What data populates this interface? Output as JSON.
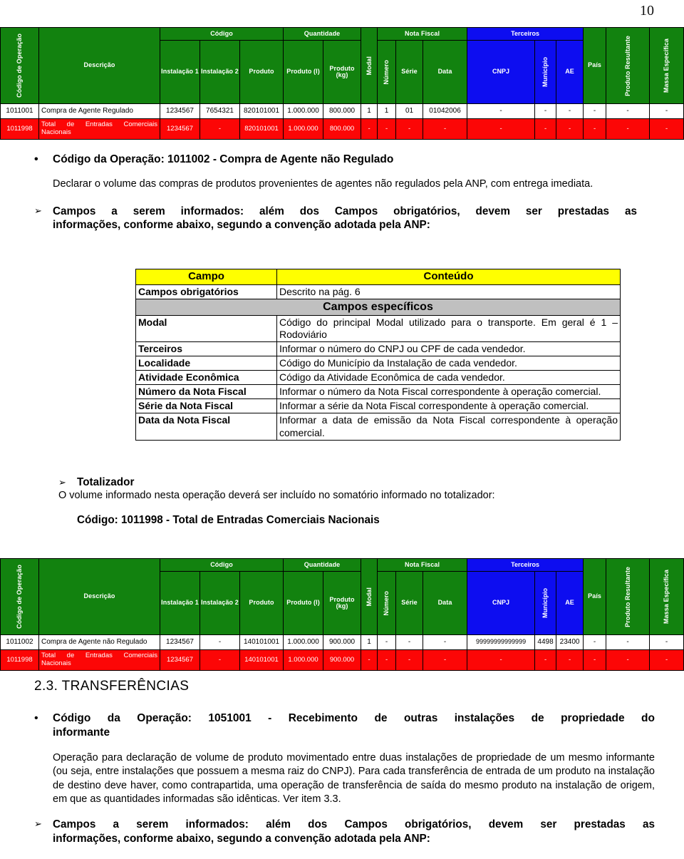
{
  "page": {
    "number": "10"
  },
  "table_top": {
    "group_headers": {
      "codigo": "Código",
      "quantidade": "Quantidade",
      "nota_fiscal": "Nota Fiscal",
      "terceiros": "Terceiros"
    },
    "columns": {
      "codigo_operacao": "Código de Operação",
      "descricao": "Descrição",
      "instalacao1": "Instalação 1",
      "instalacao2": "Instalação 2",
      "produto": "Produto",
      "produto_l": "Produto (l)",
      "produto_kg": "Produto (kg)",
      "modal": "Modal",
      "numero": "Número",
      "serie": "Série",
      "data": "Data",
      "cnpj": "CNPJ",
      "municipio": "Município",
      "ae": "AE",
      "pais": "País",
      "produto_resultante": "Produto Resultante",
      "massa_especifica": "Massa Específica"
    },
    "rows": [
      {
        "codigo_operacao": "1011001",
        "descricao": "Compra de Agente Regulado",
        "instalacao1": "1234567",
        "instalacao2": "7654321",
        "produto": "820101001",
        "produto_l": "1.000.000",
        "produto_kg": "800.000",
        "modal": "1",
        "numero": "1",
        "serie": "01",
        "data": "01042006",
        "cnpj": "-",
        "municipio": "-",
        "ae": "-",
        "pais": "-",
        "produto_resultante": "-",
        "massa_especifica": "-",
        "highlight": "white"
      },
      {
        "codigo_operacao": "1011998",
        "descricao": "Total de Entradas Comerciais Nacionais",
        "instalacao1": "1234567",
        "instalacao2": "-",
        "produto": "820101001",
        "produto_l": "1.000.000",
        "produto_kg": "800.000",
        "modal": "-",
        "numero": "-",
        "serie": "-",
        "data": "-",
        "cnpj": "-",
        "municipio": "-",
        "ae": "-",
        "pais": "-",
        "produto_resultante": "-",
        "massa_especifica": "-",
        "highlight": "red"
      }
    ]
  },
  "section_1011002": {
    "bullet": "•",
    "heading": "Código da Operação: 1011002 - Compra de Agente não Regulado",
    "description": "Declarar o volume das compras de produtos provenientes de agentes não regulados pela ANP, com entrega imediata.",
    "arrow": "➢",
    "campos_intro_line1": "Campos a serem informados: além dos Campos obrigatórios, devem ser prestadas as",
    "campos_intro_line2": "informações, conforme abaixo, segundo a convenção adotada pela ANP:"
  },
  "campo_table": {
    "header": {
      "campo": "Campo",
      "conteudo": "Conteúdo"
    },
    "obrigatorios": {
      "campo": "Campos obrigatórios",
      "conteudo": "Descrito na pág. 6"
    },
    "specific_banner": "Campos específicos",
    "rows": [
      {
        "campo": "Modal",
        "conteudo": "Código do principal Modal utilizado para o transporte. Em geral é 1 – Rodoviário"
      },
      {
        "campo": "Terceiros",
        "conteudo": "Informar o número do CNPJ ou CPF de cada vendedor."
      },
      {
        "campo": "Localidade",
        "conteudo": "Código do Município da Instalação de cada vendedor."
      },
      {
        "campo": "Atividade Econômica",
        "conteudo": "Código da Atividade Econômica de cada vendedor."
      },
      {
        "campo": "Número da Nota Fiscal",
        "conteudo": "Informar o número da Nota Fiscal correspondente à operação comercial."
      },
      {
        "campo": "Série da Nota Fiscal",
        "conteudo": "Informar a série da Nota Fiscal correspondente à operação comercial."
      },
      {
        "campo": "Data da Nota Fiscal",
        "conteudo": "Informar a data de emissão da Nota Fiscal correspondente à operação comercial."
      }
    ]
  },
  "totalizador": {
    "arrow": "➢",
    "title": "Totalizador",
    "text": "O volume informado nesta operação deverá ser incluído no somatório informado no totalizador:",
    "codigo": "Código: 1011998 - Total de Entradas Comerciais Nacionais"
  },
  "table_bottom": {
    "group_headers": {
      "codigo": "Código",
      "quantidade": "Quantidade",
      "nota_fiscal": "Nota Fiscal",
      "terceiros": "Terceiros"
    },
    "columns": {
      "codigo_operacao": "Código de Operação",
      "descricao": "Descrição",
      "instalacao1": "Instalação 1",
      "instalacao2": "Instalação 2",
      "produto": "Produto",
      "produto_l": "Produto (l)",
      "produto_kg": "Produto (kg)",
      "modal": "Modal",
      "numero": "Número",
      "serie": "Série",
      "data": "Data",
      "cnpj": "CNPJ",
      "municipio": "Município",
      "ae": "AE",
      "pais": "País",
      "produto_resultante": "Produto Resultante",
      "massa_especifica": "Massa Específica"
    },
    "rows": [
      {
        "codigo_operacao": "1011002",
        "descricao": "Compra de Agente não Regulado",
        "instalacao1": "1234567",
        "instalacao2": "-",
        "produto": "140101001",
        "produto_l": "1.000.000",
        "produto_kg": "900.000",
        "modal": "1",
        "numero": "-",
        "serie": "-",
        "data": "-",
        "cnpj": "99999999999999",
        "municipio": "4498",
        "ae": "23400",
        "pais": "-",
        "produto_resultante": "-",
        "massa_especifica": "-",
        "highlight": "white"
      },
      {
        "codigo_operacao": "1011998",
        "descricao": "Total de Entradas Comerciais Nacionais",
        "instalacao1": "1234567",
        "instalacao2": "-",
        "produto": "140101001",
        "produto_l": "1.000.000",
        "produto_kg": "900.000",
        "modal": "-",
        "numero": "-",
        "serie": "-",
        "data": "-",
        "cnpj": "-",
        "municipio": "-",
        "ae": "-",
        "pais": "-",
        "produto_resultante": "-",
        "massa_especifica": "-",
        "highlight": "red"
      }
    ]
  },
  "section_transferencias": {
    "number_title": "2.3.  TRANSFERÊNCIAS",
    "bullet": "•",
    "heading_line1": "Código da Operação: 1051001 - Recebimento de outras instalações de propriedade do",
    "heading_line2": "informante",
    "paragraph": "Operação para declaração de volume de produto movimentado entre duas instalações de propriedade de um mesmo informante (ou seja, entre instalações que possuem a mesma raiz do CNPJ). Para cada transferência de entrada de um produto na instalação de destino deve haver, como contrapartida, uma operação de transferência de saída do mesmo produto na instalação de origem, em que as quantidades informadas são idênticas. Ver item 3.3.",
    "arrow": "➢",
    "campos_intro_line1": "Campos a serem informados: além dos Campos obrigatórios, devem ser prestadas as",
    "campos_intro_line2": "informações, conforme abaixo, segundo a convenção adotada pela ANP:"
  },
  "colors": {
    "header_green": "#12820f",
    "header_blue": "#0d0df0",
    "total_red": "#fc0606",
    "campo_yellow": "#ffff00",
    "span_gray": "#c0c0c0"
  }
}
